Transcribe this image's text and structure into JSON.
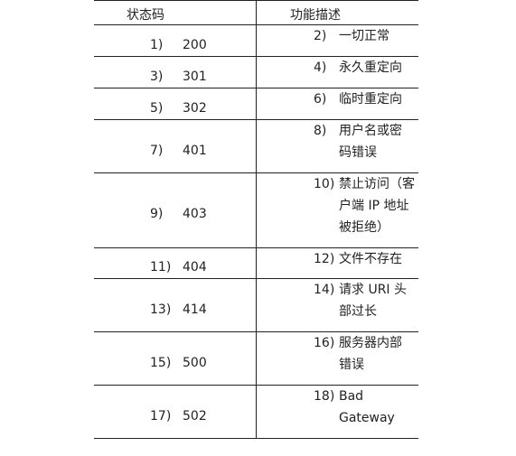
{
  "header": {
    "status_code": "状态码",
    "function_desc": "功能描述"
  },
  "rows": [
    {
      "code_no": "1)",
      "code": "200",
      "desc_no": "2)",
      "desc": "一切正常"
    },
    {
      "code_no": "3)",
      "code": "301",
      "desc_no": "4)",
      "desc": "永久重定向"
    },
    {
      "code_no": "5)",
      "code": "302",
      "desc_no": "6)",
      "desc": "临时重定向"
    },
    {
      "code_no": "7)",
      "code": "401",
      "desc_no": "8)",
      "desc": "用户名或密码错误"
    },
    {
      "code_no": "9)",
      "code": "403",
      "desc_no": "10)",
      "desc": "禁止访问（客户端 IP 地址被拒绝）"
    },
    {
      "code_no": "11)",
      "code": "404",
      "desc_no": "12)",
      "desc": "文件不存在"
    },
    {
      "code_no": "13)",
      "code": "414",
      "desc_no": "14)",
      "desc": "请求 URI 头部过长"
    },
    {
      "code_no": "15)",
      "code": "500",
      "desc_no": "16)",
      "desc": "服务器内部错误"
    },
    {
      "code_no": "17)",
      "code": "502",
      "desc_no": "18)",
      "desc": "Bad Gateway"
    }
  ]
}
